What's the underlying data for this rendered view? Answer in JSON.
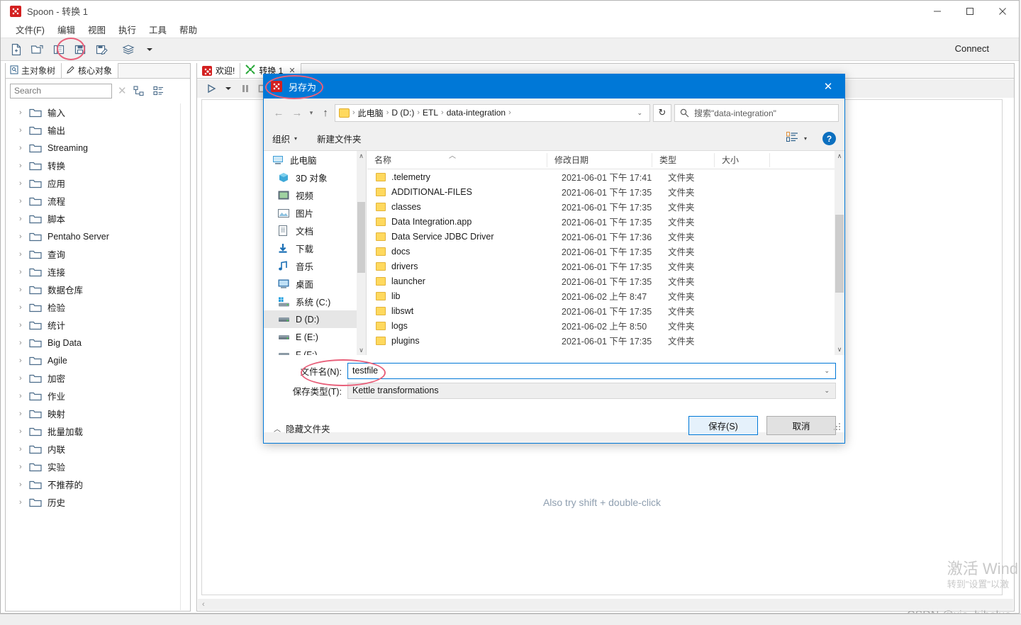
{
  "window": {
    "app_name": "Spoon",
    "title": "Spoon - 转换 1",
    "title_sep": "-",
    "doc_name": "转换 1",
    "minimize": "—",
    "maximize": "□",
    "close": "✕"
  },
  "menubar": {
    "items": [
      "文件(F)",
      "编辑",
      "视图",
      "执行",
      "工具",
      "帮助"
    ]
  },
  "toolbar": {
    "buttons": [
      {
        "name": "new-file",
        "icon": "new-file-icon"
      },
      {
        "name": "open-file",
        "icon": "open-folder-icon"
      },
      {
        "name": "explore",
        "icon": "explore-icon"
      },
      {
        "name": "save",
        "icon": "save-disk-icon"
      },
      {
        "name": "save-as",
        "icon": "save-as-icon"
      },
      {
        "name": "layers",
        "icon": "layers-icon"
      },
      {
        "name": "layers-dropdown",
        "icon": "chevron-down-icon"
      }
    ],
    "connect_label": "Connect"
  },
  "left_panel": {
    "tabs": [
      {
        "label": "主对象树",
        "icon": "document-icon",
        "active": false
      },
      {
        "label": "核心对象",
        "icon": "pencil-icon",
        "active": true
      }
    ],
    "search": {
      "placeholder": "Search",
      "value": "",
      "clear_icon": "close-icon",
      "expand_all_icon": "expand-tree-icon",
      "collapse_all_icon": "collapse-tree-icon"
    },
    "tree_items": [
      "输入",
      "输出",
      "Streaming",
      "转换",
      "应用",
      "流程",
      "脚本",
      "Pentaho Server",
      "查询",
      "连接",
      "数据仓库",
      "检验",
      "统计",
      "Big Data",
      "Agile",
      "加密",
      "作业",
      "映射",
      "批量加载",
      "内联",
      "实验",
      "不推荐的",
      "历史"
    ]
  },
  "canvas_area": {
    "tabs": [
      {
        "label": "欢迎!",
        "icon": "spoon-icon",
        "closable": false,
        "active": false
      },
      {
        "label": "转换 1",
        "icon": "transform-icon",
        "closable": true,
        "close_label": "✕",
        "active": true
      }
    ],
    "toolbar_buttons": [
      {
        "name": "run",
        "icon": "play-icon"
      },
      {
        "name": "run-options",
        "icon": "chevron-down-icon"
      },
      {
        "name": "pause",
        "icon": "pause-icon"
      },
      {
        "name": "stop",
        "icon": "stop-icon"
      }
    ],
    "hint_text": "Also try shift + double-click"
  },
  "dialog": {
    "title": "另存为",
    "title_icon": "spoon-icon",
    "close_label": "✕",
    "nav": {
      "back_icon": "arrow-left-icon",
      "forward_icon": "arrow-right-icon",
      "recent_icon": "chevron-down-icon",
      "up_icon": "arrow-up-icon",
      "breadcrumbs": [
        "此电脑",
        "D (D:)",
        "ETL",
        "data-integration"
      ],
      "separator": "›",
      "dropdown_caret": "⌄",
      "refresh_icon": "refresh-icon",
      "search_placeholder": "搜索\"data-integration\"",
      "search_icon": "search-icon"
    },
    "toolbar": {
      "organize_label": "组织",
      "new_folder_label": "新建文件夹",
      "caret": "▾",
      "view_icon": "view-list-icon",
      "view_caret": "▾",
      "help_label": "?"
    },
    "nav_pane": [
      {
        "label": "此电脑",
        "icon": "computer-icon",
        "indent": 0,
        "selected": false
      },
      {
        "label": "3D 对象",
        "icon": "cube-icon",
        "indent": 1,
        "selected": false
      },
      {
        "label": "视频",
        "icon": "video-icon",
        "indent": 1,
        "selected": false
      },
      {
        "label": "图片",
        "icon": "pictures-icon",
        "indent": 1,
        "selected": false
      },
      {
        "label": "文档",
        "icon": "documents-icon",
        "indent": 1,
        "selected": false
      },
      {
        "label": "下载",
        "icon": "downloads-icon",
        "indent": 1,
        "selected": false
      },
      {
        "label": "音乐",
        "icon": "music-icon",
        "indent": 1,
        "selected": false
      },
      {
        "label": "桌面",
        "icon": "desktop-icon",
        "indent": 1,
        "selected": false
      },
      {
        "label": "系统 (C:)",
        "icon": "windows-drive-icon",
        "indent": 1,
        "selected": false
      },
      {
        "label": "D (D:)",
        "icon": "drive-icon",
        "indent": 1,
        "selected": true
      },
      {
        "label": "E (E:)",
        "icon": "drive-icon",
        "indent": 1,
        "selected": false
      },
      {
        "label": "F (F:)",
        "icon": "drive-icon",
        "indent": 1,
        "selected": false
      }
    ],
    "file_list": {
      "columns": [
        "名称",
        "修改日期",
        "类型",
        "大小"
      ],
      "sort_column": "名称",
      "sort_caret": "︿",
      "rows": [
        {
          "name": ".telemetry",
          "date": "2021-06-01 下午 17:41",
          "type": "文件夹",
          "size": ""
        },
        {
          "name": "ADDITIONAL-FILES",
          "date": "2021-06-01 下午 17:35",
          "type": "文件夹",
          "size": ""
        },
        {
          "name": "classes",
          "date": "2021-06-01 下午 17:35",
          "type": "文件夹",
          "size": ""
        },
        {
          "name": "Data Integration.app",
          "date": "2021-06-01 下午 17:35",
          "type": "文件夹",
          "size": ""
        },
        {
          "name": "Data Service JDBC Driver",
          "date": "2021-06-01 下午 17:36",
          "type": "文件夹",
          "size": ""
        },
        {
          "name": "docs",
          "date": "2021-06-01 下午 17:35",
          "type": "文件夹",
          "size": ""
        },
        {
          "name": "drivers",
          "date": "2021-06-01 下午 17:35",
          "type": "文件夹",
          "size": ""
        },
        {
          "name": "launcher",
          "date": "2021-06-01 下午 17:35",
          "type": "文件夹",
          "size": ""
        },
        {
          "name": "lib",
          "date": "2021-06-02 上午 8:47",
          "type": "文件夹",
          "size": ""
        },
        {
          "name": "libswt",
          "date": "2021-06-01 下午 17:35",
          "type": "文件夹",
          "size": ""
        },
        {
          "name": "logs",
          "date": "2021-06-02 上午 8:50",
          "type": "文件夹",
          "size": ""
        },
        {
          "name": "plugins",
          "date": "2021-06-01 下午 17:35",
          "type": "文件夹",
          "size": ""
        }
      ]
    },
    "filename": {
      "label": "文件名(N):",
      "value": "testfile",
      "caret": "⌄"
    },
    "filetype": {
      "label": "保存类型(T):",
      "value": "Kettle transformations",
      "caret": "⌄"
    },
    "hide_folders": {
      "label": "隐藏文件夹",
      "caret": "︿"
    },
    "buttons": {
      "save": "保存(S)",
      "cancel": "取消"
    }
  },
  "watermark": {
    "activate_line1": "激活 Wind",
    "activate_line2": "转到\"设置\"以激",
    "credit": "CSDN @xia_biboluo"
  },
  "colors": {
    "accent": "#0078d7",
    "annotation": "#e8607a",
    "folder": "#ffd95e",
    "spoon_red": "#d32020"
  }
}
